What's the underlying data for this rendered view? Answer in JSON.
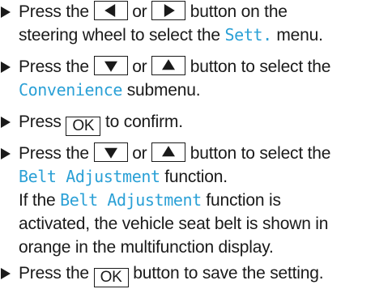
{
  "colors": {
    "highlight": "#2aa0d6",
    "text": "#1a1a1a"
  },
  "step1": {
    "a": "Press the",
    "b": "or",
    "c": "button on the",
    "d": "steering wheel to select the",
    "menu": "Sett.",
    "e": "menu."
  },
  "step2": {
    "a": "Press the",
    "b": "or",
    "c": "button to select the",
    "submenu": "Convenience",
    "d": "submenu."
  },
  "step3": {
    "a": "Press",
    "key": "OK",
    "b": "to confirm."
  },
  "step4": {
    "a": "Press the",
    "b": "or",
    "c": "button to select the",
    "function": "Belt Adjustment",
    "d": "function.",
    "note_a": "If the",
    "note_function": "Belt Adjustment",
    "note_b": "function is",
    "note_c": "activated, the vehicle seat belt is shown in",
    "note_d": "orange in the multifunction display."
  },
  "step5": {
    "a": "Press the",
    "key": "OK",
    "b": "button to save the setting."
  },
  "icons": {
    "bullet": "triangle-right",
    "left": "arrow-left",
    "right": "arrow-right",
    "down": "arrow-down",
    "up": "arrow-up"
  }
}
